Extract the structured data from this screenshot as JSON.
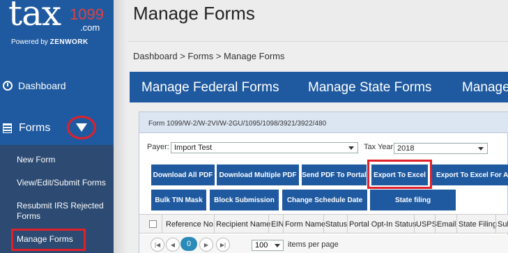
{
  "logo": {
    "tax": "tax",
    "num": "1099",
    "com": ".com",
    "powered": "Powered by",
    "zenwork": "ZENWORK"
  },
  "sidebar": {
    "dashboard": "Dashboard",
    "forms": "Forms",
    "submenu": [
      "New Form",
      "View/Edit/Submit Forms",
      "Resubmit IRS Rejected Forms",
      "Manage Forms"
    ]
  },
  "header": {
    "title": "Manage Forms"
  },
  "breadcrumb": "Dashboard > Forms > Manage Forms",
  "tabs": [
    "Manage Federal Forms",
    "Manage State Forms",
    "Manage"
  ],
  "panel": {
    "title": "Form 1099/W-2/W-2VI/W-2GU/1095/1098/3921/3922/480",
    "payer_label": "Payer:",
    "payer_value": "Import Test",
    "tax_year_label": "Tax Year:",
    "tax_year_value": "2018"
  },
  "buttons": {
    "row1": [
      "Download All PDF",
      "Download Multiple PDF",
      "Send PDF To Portal",
      "Export To Excel",
      "Export To Excel For All F"
    ],
    "row2": [
      "Bulk TIN Mask",
      "Block Submission",
      "Change Schedule Date",
      "State filing"
    ]
  },
  "table": {
    "columns": [
      "Reference No.",
      "Recipient Name",
      "EIN",
      "Form Name",
      "Status",
      "Portal Opt-In Status",
      "USPS",
      "Email",
      "State Filing",
      "Sub"
    ]
  },
  "pager": {
    "current": "0",
    "page_size": "100",
    "label": "items per page"
  },
  "colors": {
    "brand_blue": "#1f5aa0",
    "highlight_red": "#e0202a",
    "submenu_bg": "#2c4a72"
  }
}
